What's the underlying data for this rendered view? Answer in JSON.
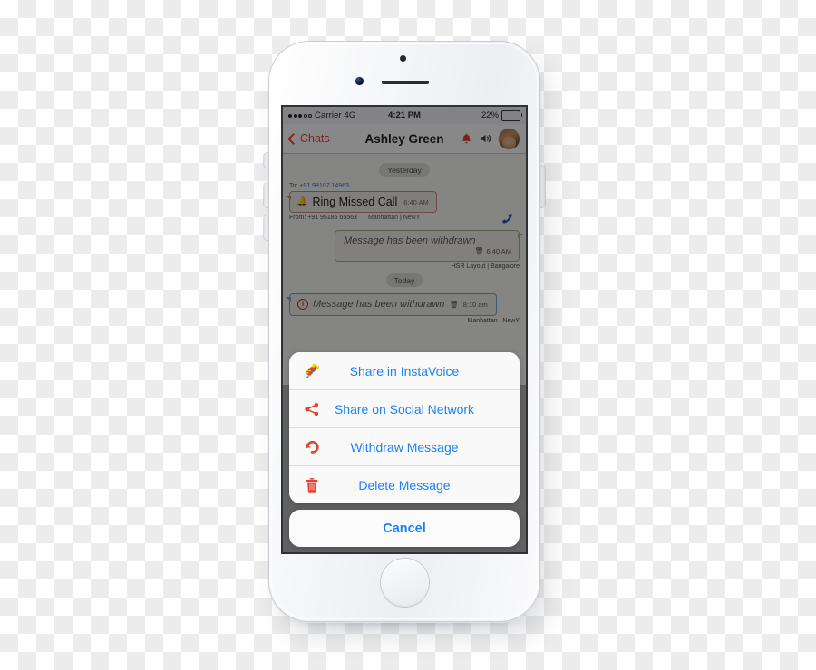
{
  "device": {
    "name": "iPhone white",
    "frame_color": "#f2f3f5"
  },
  "status_bar": {
    "carrier": "Carrier 4G",
    "signal_dots_filled": 3,
    "signal_dots_total": 5,
    "time": "4:21 PM",
    "battery_percent": "22%",
    "battery_level": 22
  },
  "nav_bar": {
    "back_label": "Chats",
    "back_icon": "chevron-left-icon",
    "title": "Ashley Green",
    "actions": [
      {
        "icon": "bell-icon",
        "color": "#d14236"
      },
      {
        "icon": "speaker-icon",
        "color": "#3f3f41"
      },
      {
        "icon": "avatar",
        "color": "#b98a5e"
      }
    ]
  },
  "chat": {
    "separators": {
      "yesterday": "Yesterday",
      "today": "Today"
    },
    "messages": [
      {
        "type": "missed-call",
        "side": "left",
        "to_label": "To:",
        "to_number": "+91 98107 14963",
        "title": "Ring Missed Call",
        "time": "6:40 AM",
        "from_label": "From:",
        "from_number": "+91 95186 65563",
        "location": "Manhattan | NewY",
        "icon": "bell-red-icon",
        "call_icon": "phone-icon"
      },
      {
        "type": "withdrawn",
        "side": "right",
        "text": "Message has been withdrawn",
        "time": "6:40 AM",
        "location": "HSR Layout | Bangalore",
        "icon": "trash-icon"
      },
      {
        "type": "withdrawn",
        "side": "left",
        "text": "Message has been withdrawn",
        "time": "8:10 am",
        "location": "Manhattan | NewY",
        "icon": "trash-icon",
        "lead_icon": "info-circle-icon"
      }
    ]
  },
  "action_sheet": {
    "items": [
      {
        "label": "Share in InstaVoice",
        "icon": "parrot-icon"
      },
      {
        "label": "Share on Social Network",
        "icon": "share-icon"
      },
      {
        "label": "Withdraw Message",
        "icon": "undo-icon"
      },
      {
        "label": "Delete Message",
        "icon": "trash-icon"
      }
    ],
    "cancel_label": "Cancel",
    "accent_color": "#1a82f7",
    "icon_color": "#e8402f"
  }
}
